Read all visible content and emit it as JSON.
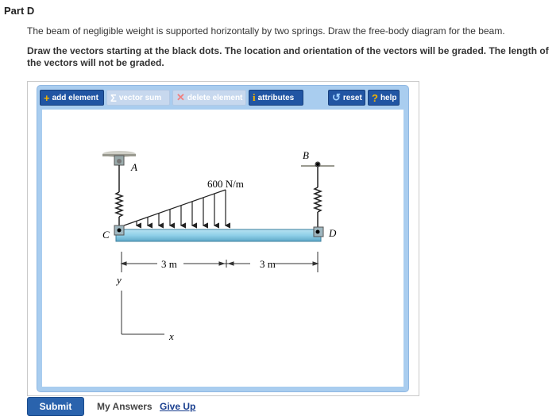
{
  "part": {
    "title": "Part D"
  },
  "problem": {
    "description": "The beam of negligible weight is supported horizontally by two springs. Draw the free-body diagram for the beam.",
    "instruction": "Draw the vectors starting at the black dots. The location and orientation of the vectors will be graded. The length of the vectors will not be graded."
  },
  "toolbar": {
    "add_element": "add element",
    "vector_sum": "vector sum",
    "delete_element": "delete element",
    "attributes": "attributes",
    "reset": "reset",
    "help": "help"
  },
  "diagram": {
    "load_label": "600 N/m",
    "point_a": "A",
    "point_b": "B",
    "point_c": "C",
    "point_d": "D",
    "dim_left": "3 m",
    "dim_right": "3 m",
    "axis_y": "y",
    "axis_x": "x"
  },
  "footer": {
    "submit": "Submit",
    "my_answers": "My Answers",
    "give_up": "Give Up"
  },
  "colors": {
    "toolbar_button": "#2155a3",
    "frame": "#a9cdef",
    "beam": "#8fd0e8"
  }
}
